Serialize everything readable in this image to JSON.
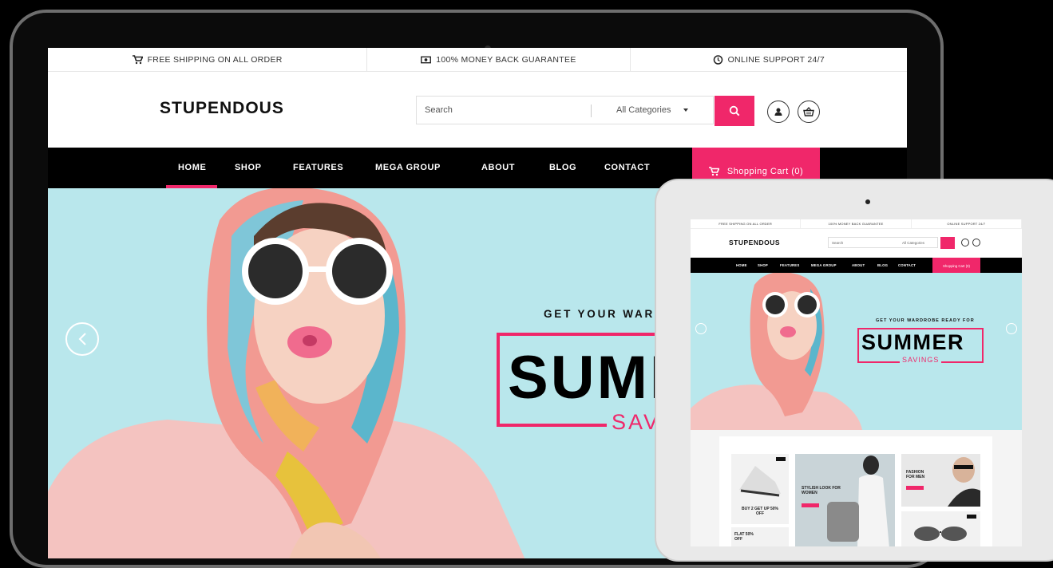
{
  "topbar": {
    "items": [
      {
        "icon": "cart-icon",
        "label": "FREE SHIPPING ON ALL ORDER"
      },
      {
        "icon": "money-icon",
        "label": "100% MONEY BACK GUARANTEE"
      },
      {
        "icon": "clock-icon",
        "label": "ONLINE SUPPORT 24/7"
      }
    ]
  },
  "header": {
    "logo": "STUPENDOUS",
    "search_placeholder": "Search",
    "category": "All Categories"
  },
  "nav": {
    "items": [
      "HOME",
      "SHOP",
      "FEATURES",
      "MEGA GROUP",
      "ABOUT",
      "BLOG",
      "CONTACT"
    ],
    "active": "HOME",
    "cart_label": "Shopping Cart (0)"
  },
  "hero": {
    "tagline": "GET YOUR WARD",
    "title": "SUMM",
    "subtitle": "SAV"
  },
  "tablet": {
    "topbar": [
      "FREE SHIPPING ON ALL ORDER",
      "100% MONEY BACK GUARANTEE",
      "ONLINE SUPPORT 24/7"
    ],
    "logo": "STUPENDOUS",
    "search_placeholder": "Search",
    "category": "All Categories",
    "nav": [
      "HOME",
      "SHOP",
      "FEATURES",
      "MEGA GROUP",
      "ABOUT",
      "BLOG",
      "CONTACT"
    ],
    "cart_label": "Shopping Cart (0)",
    "hero_tagline": "GET YOUR WARDROBE READY FOR",
    "hero_title": "SUMMER",
    "hero_subtitle": "SAVINGS",
    "promo_1": "BUY 2 GET UP 50% OFF",
    "promo_2": "STYLISH LOOK FOR WOMEN",
    "promo_3": "FASHION FOR MEN",
    "promo_4": "FLAT 50% OFF"
  },
  "colors": {
    "accent": "#f0276a",
    "hero_bg": "#b9e7ec",
    "nav_bg": "#000000"
  }
}
